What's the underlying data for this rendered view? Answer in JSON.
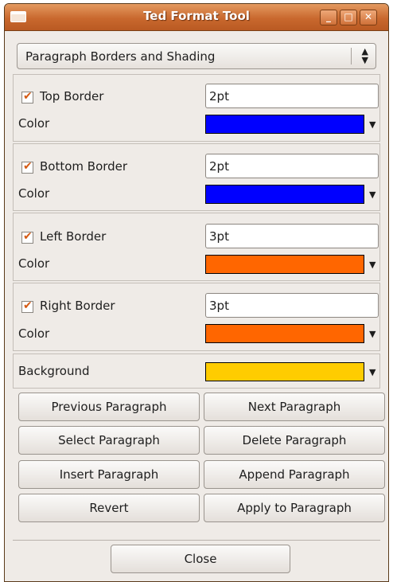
{
  "window": {
    "title": "Ted Format Tool",
    "min_symbol": "_",
    "max_symbol": "□",
    "close_symbol": "✕"
  },
  "selector": {
    "value": "Paragraph Borders and Shading",
    "arrows": "▲\n▼"
  },
  "borders": [
    {
      "label": "Top Border",
      "checked": true,
      "width": "2pt",
      "color_label": "Color",
      "color": "#0000ff"
    },
    {
      "label": "Bottom Border",
      "checked": true,
      "width": "2pt",
      "color_label": "Color",
      "color": "#0000ff"
    },
    {
      "label": "Left Border",
      "checked": true,
      "width": "3pt",
      "color_label": "Color",
      "color": "#ff6600"
    },
    {
      "label": "Right Border",
      "checked": true,
      "width": "3pt",
      "color_label": "Color",
      "color": "#ff6600"
    }
  ],
  "background": {
    "label": "Background",
    "color": "#ffcc00"
  },
  "dropdown_glyph": "▼",
  "check_glyph": "✔",
  "buttons": {
    "previous": "Previous Paragraph",
    "next": "Next Paragraph",
    "select": "Select Paragraph",
    "delete": "Delete Paragraph",
    "insert": "Insert Paragraph",
    "append": "Append Paragraph",
    "revert": "Revert",
    "apply": "Apply to Paragraph",
    "close": "Close"
  }
}
